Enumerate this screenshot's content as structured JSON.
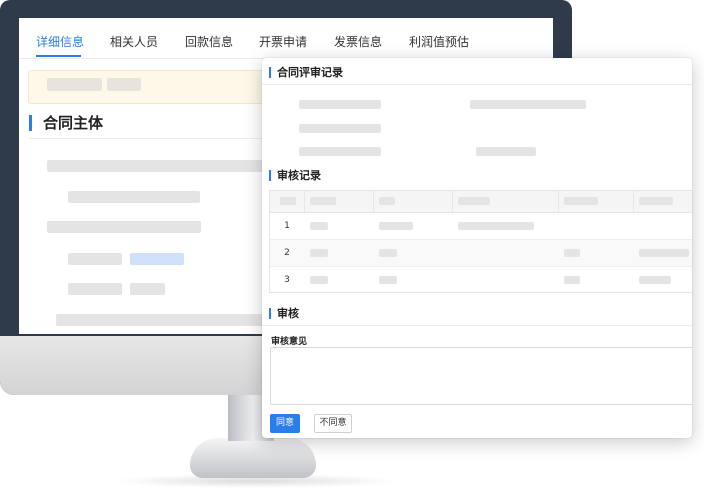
{
  "tabs": [
    {
      "label": "详细信息",
      "active": true
    },
    {
      "label": "相关人员",
      "active": false
    },
    {
      "label": "回款信息",
      "active": false
    },
    {
      "label": "开票申请",
      "active": false
    },
    {
      "label": "发票信息",
      "active": false
    },
    {
      "label": "利润值预估",
      "active": false
    }
  ],
  "main": {
    "section_title": "合同主体"
  },
  "dialog": {
    "review_title": "合同评审记录",
    "audit_title": "审核记录",
    "audit_rows": [
      "1",
      "2",
      "3"
    ],
    "approve_title": "审核",
    "opinion_label": "审核意见",
    "opinion_value": "",
    "agree_label": "同意",
    "disagree_label": "不同意"
  },
  "colors": {
    "accent": "#2b7de9",
    "notice_bg": "#fdf8e8",
    "monitor_bezel": "#2f3a4b"
  }
}
